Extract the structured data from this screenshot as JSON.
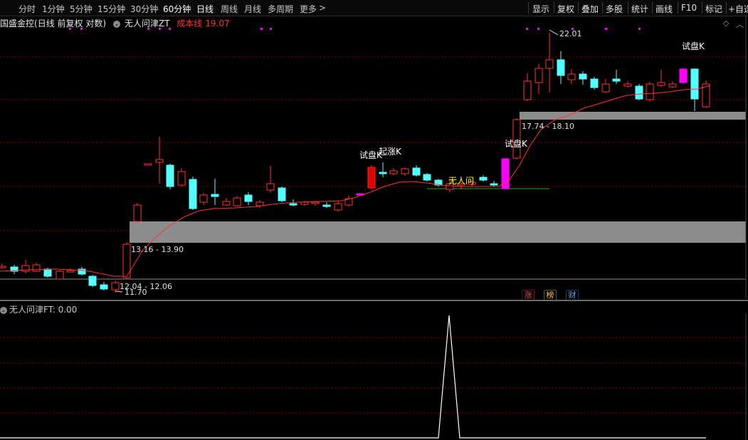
{
  "toolbar": {
    "periods": [
      "分时",
      "1分钟",
      "5分钟",
      "15分钟",
      "30分钟",
      "60分钟",
      "日线",
      "周线",
      "月线",
      "多周期",
      "更多"
    ],
    "more_arrow": ">",
    "active_period": "日线",
    "right_buttons": [
      "显示",
      "复权",
      "叠加",
      "多股",
      "统计",
      "画线",
      "F10",
      "标记",
      "+自选"
    ]
  },
  "info": {
    "stock_name": "国盛金控",
    "chart_mode": "(日线 前复权 对数)",
    "indicator_name": "无人问津ZT",
    "cost_label": "成本线",
    "cost_value": "19.07"
  },
  "annotations": {
    "high_price": "22.01",
    "low_price": "11.70",
    "zone_low": "12.04 - 12.06",
    "zone_mid": "13.16 - 13.90",
    "zone_high": "17.74 - 18.10",
    "trial_k": "试盘K",
    "rise_k": "起涨K",
    "wurenwen": "无人问"
  },
  "chips": [
    "涨",
    "榜",
    "财"
  ],
  "sub_indicator": {
    "name": "无人问津FT",
    "value_label": ": 0.00"
  },
  "colors": {
    "background": "#000000",
    "up": "#ff3232",
    "down": "#54ffff",
    "trial": "#ff00ff",
    "rise_bar": "#e00000",
    "zone": "#8c8c8c",
    "cost_line": "#ff3232",
    "grid": "#8b0000",
    "sub_line": "#ffffff"
  }
}
